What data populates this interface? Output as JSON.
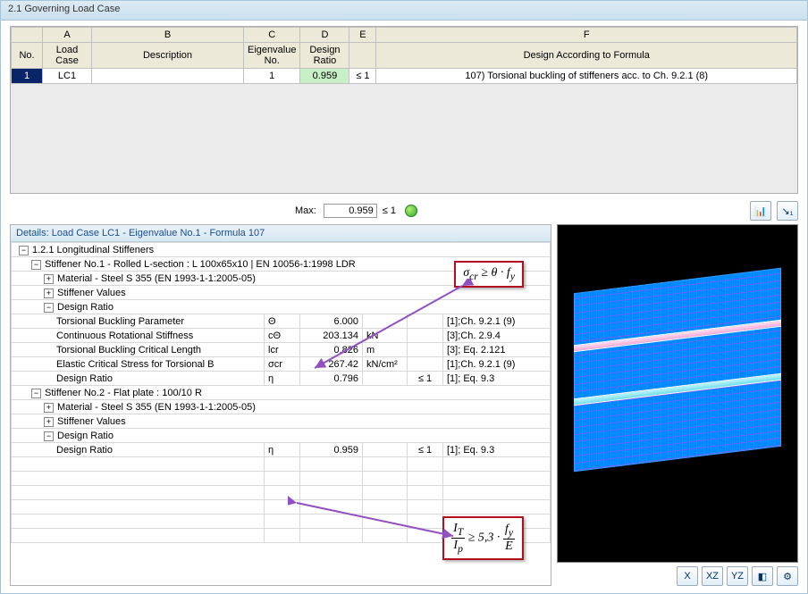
{
  "title": "2.1 Governing Load Case",
  "topgrid": {
    "letters": [
      "A",
      "B",
      "C",
      "D",
      "E",
      "F"
    ],
    "headers": {
      "no": "No.",
      "lc": "Load\nCase",
      "desc": "Description",
      "eig": "Eigenvalue\nNo.",
      "ratio": "Design\nRatio",
      "le": "",
      "formula": "Design According to Formula"
    },
    "row": {
      "no": "1",
      "lc": "LC1",
      "desc": "",
      "eig": "1",
      "ratio": "0.959",
      "le": "≤ 1",
      "formula": "107) Torsional buckling of stiffeners acc. to Ch. 9.2.1 (8)"
    }
  },
  "maxrow": {
    "label": "Max:",
    "value": "0.959",
    "le": "≤ 1"
  },
  "details": {
    "header": "Details:  Load Case LC1 - Eigenvalue No.1 - Formula 107",
    "section121": "1.2.1 Longitudinal Stiffeners",
    "stiff1": "Stiffener No.1 - Rolled L-section : L 100x65x10 | EN 10056-1:1998 LDR",
    "stiff2": "Stiffener No.2 - Flat plate : 100/10 R",
    "material": "Material - Steel S 355 (EN 1993-1-1:2005-05)",
    "stiffvalues": "Stiffener Values",
    "designratio": "Design Ratio",
    "rows1": [
      {
        "label": "Torsional Buckling Parameter",
        "sym": "Θ",
        "val": "6.000",
        "unit": "",
        "cond": "",
        "ref": "[1];Ch. 9.2.1 (9)"
      },
      {
        "label": "Continuous Rotational Stiffness",
        "sym": "cΘ",
        "val": "203.134",
        "unit": "kN",
        "cond": "",
        "ref": "[3];Ch. 2.9.4"
      },
      {
        "label": "Torsional Buckling Critical Length",
        "sym": "lcr",
        "val": "0.826",
        "unit": "m",
        "cond": "",
        "ref": "[3]; Eq. 2.121"
      },
      {
        "label": "Elastic Critical Stress for Torsional B",
        "sym": "σcr",
        "val": "267.42",
        "unit": "kN/cm²",
        "cond": "",
        "ref": "[1];Ch. 9.2.1 (9)"
      },
      {
        "label": "Design Ratio",
        "sym": "η",
        "val": "0.796",
        "unit": "",
        "cond": "≤ 1",
        "ref": "[1]; Eq. 9.3"
      }
    ],
    "rows2": [
      {
        "label": "Design Ratio",
        "sym": "η",
        "val": "0.959",
        "unit": "",
        "cond": "≤ 1",
        "ref": "[1]; Eq. 9.3"
      }
    ]
  },
  "callouts": {
    "top": "σcr ≥ θ · fy",
    "bottom_html": "<span style='display:inline-block;vertical-align:middle;text-align:center'><span style='border-bottom:1px solid #000;display:block;padding:0 2px'>I<sub>T</sub></span><span style='display:block;padding:0 2px'>I<sub>p</sub></span></span> ≥ 5,3 · <span style='display:inline-block;vertical-align:middle;text-align:center'><span style='border-bottom:1px solid #000;display:block;padding:0 2px'>f<sub>y</sub></span><span style='display:block;padding:0 2px'>E</span></span>"
  },
  "viewbuttons": [
    "X",
    "XZ",
    "YZ",
    "◧",
    "⚙"
  ]
}
